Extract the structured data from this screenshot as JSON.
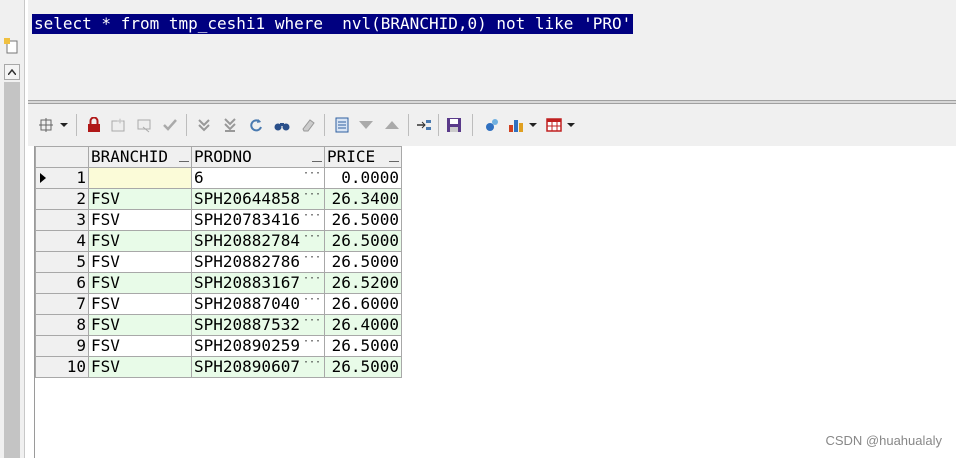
{
  "editor": {
    "sql": "select * from tmp_ceshi1 where  nvl(BRANCHID,0) not like 'PRO'"
  },
  "toolbar": {
    "icons": [
      "grid-options-icon",
      "lock-icon",
      "add-record-icon",
      "delete-record-icon",
      "post-changes-icon",
      "next-page-icon",
      "last-page-icon",
      "refresh-icon",
      "find-icon",
      "clear-icon",
      "query-by-example-icon",
      "filter-icon",
      "sort-icon",
      "export-icon",
      "save-icon",
      "link-icon",
      "chart-icon",
      "table-view-icon"
    ]
  },
  "grid": {
    "columns": [
      "BRANCHID",
      "PRODNO",
      "PRICE"
    ],
    "rows": [
      {
        "n": "1",
        "branch": "",
        "prod": "6",
        "price": "0.0000"
      },
      {
        "n": "2",
        "branch": "FSV",
        "prod": "SPH20644858",
        "price": "26.3400"
      },
      {
        "n": "3",
        "branch": "FSV",
        "prod": "SPH20783416",
        "price": "26.5000"
      },
      {
        "n": "4",
        "branch": "FSV",
        "prod": "SPH20882784",
        "price": "26.5000"
      },
      {
        "n": "5",
        "branch": "FSV",
        "prod": "SPH20882786",
        "price": "26.5000"
      },
      {
        "n": "6",
        "branch": "FSV",
        "prod": "SPH20883167",
        "price": "26.5200"
      },
      {
        "n": "7",
        "branch": "FSV",
        "prod": "SPH20887040",
        "price": "26.6000"
      },
      {
        "n": "8",
        "branch": "FSV",
        "prod": "SPH20887532",
        "price": "26.4000"
      },
      {
        "n": "9",
        "branch": "FSV",
        "prod": "SPH20890259",
        "price": "26.5000"
      },
      {
        "n": "10",
        "branch": "FSV",
        "prod": "SPH20890607",
        "price": "26.5000"
      }
    ]
  },
  "watermark": "CSDN @huahualaly"
}
